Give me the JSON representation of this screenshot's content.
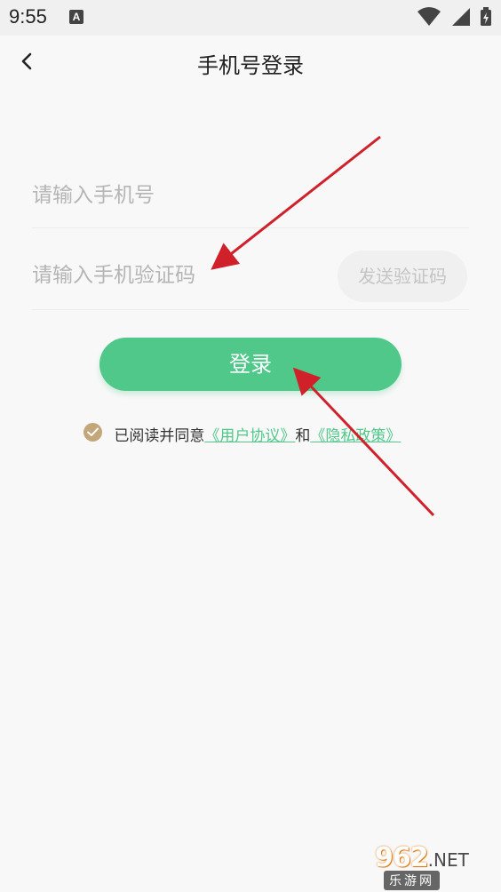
{
  "status_bar": {
    "time": "9:55",
    "notification_icon": "A"
  },
  "nav": {
    "title": "手机号登录",
    "back_icon": "chevron-left-icon"
  },
  "form": {
    "phone_placeholder": "请输入手机号",
    "phone_value": "",
    "code_placeholder": "请输入手机验证码",
    "code_value": "",
    "send_code_label": "发送验证码",
    "login_label": "登录"
  },
  "agreement": {
    "checked": true,
    "prefix": "已阅读并同意",
    "user_agreement": "《用户协议》",
    "conjunction": "和",
    "privacy_policy": "《隐私政策》"
  },
  "colors": {
    "accent": "#4fc88a",
    "check": "#c3a77a",
    "arrow": "#d0202a"
  },
  "watermark": {
    "top": "962",
    "net": ".NET",
    "bottom": "乐游网"
  }
}
